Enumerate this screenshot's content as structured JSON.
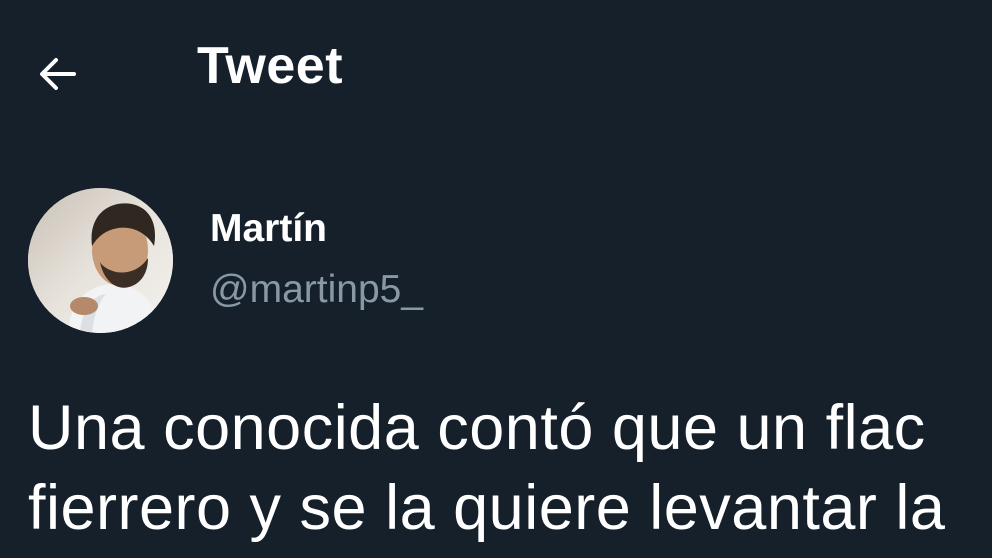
{
  "header": {
    "back_icon": "arrow-left-icon",
    "title": "Tweet"
  },
  "author": {
    "avatar_icon": "user-avatar",
    "name": "Martín",
    "handle": "@martinp5_"
  },
  "tweet": {
    "lines": [
      "Una conocida contó que un flac",
      "fierrero y se la quiere levantar la"
    ]
  },
  "colors": {
    "background": "#15202b",
    "text_primary": "#ffffff",
    "text_secondary": "#8899a6"
  }
}
